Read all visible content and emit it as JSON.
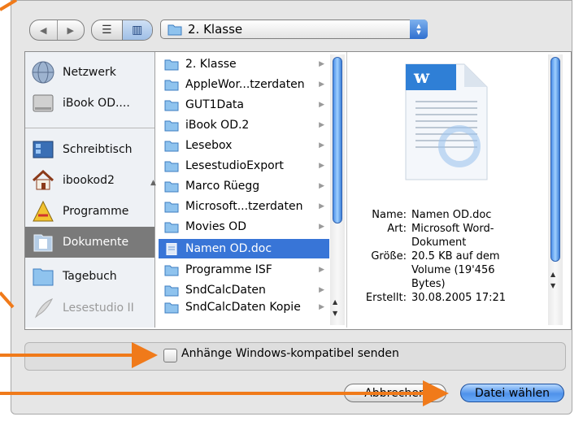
{
  "toolbar": {
    "nav_back": "◀",
    "nav_forward": "▶",
    "view_list": "☰",
    "view_columns": "▥",
    "path": "2. Klasse"
  },
  "sidebar": {
    "items": [
      {
        "label": "Netzwerk",
        "icon": "network-globe-icon"
      },
      {
        "label": "iBook OD....",
        "icon": "hard-disk-icon"
      },
      {
        "label": "Schreibtisch",
        "icon": "desktop-icon"
      },
      {
        "label": "ibookod2",
        "icon": "home-icon"
      },
      {
        "label": "Programme",
        "icon": "applications-icon"
      },
      {
        "label": "Dokumente",
        "icon": "documents-icon"
      },
      {
        "label": "Tagebuch",
        "icon": "folder-icon"
      },
      {
        "label": "Lesestudio II",
        "icon": "feather-icon"
      }
    ]
  },
  "column": {
    "items": [
      {
        "label": "2. Klasse"
      },
      {
        "label": "AppleWor...tzerdaten"
      },
      {
        "label": "GUT1Data"
      },
      {
        "label": "iBook OD.2"
      },
      {
        "label": "Lesebox"
      },
      {
        "label": "LesestudioExport"
      },
      {
        "label": "Marco Rüegg"
      },
      {
        "label": "Microsoft...tzerdaten"
      },
      {
        "label": "Movies OD"
      },
      {
        "label": "Namen OD.doc"
      },
      {
        "label": "Programme ISF"
      },
      {
        "label": "SndCalcDaten"
      },
      {
        "label": "SndCalcDaten Kopie"
      }
    ]
  },
  "preview": {
    "name_key": "Name:",
    "name_val": "Namen OD.doc",
    "kind_key": "Art:",
    "kind_val": "Microsoft Word-Dokument",
    "size_key": "Größe:",
    "size_val": "20.5 KB auf dem Volume (19'456 Bytes)",
    "created_key": "Erstellt:",
    "created_val": "30.08.2005 17:21"
  },
  "options": {
    "checkbox_label": "Anhänge Windows-kompatibel senden"
  },
  "buttons": {
    "cancel": "Abbrechen",
    "ok": "Datei wählen"
  },
  "colors": {
    "selection": "#3875d7",
    "annotation_arrow": "#f07a1a",
    "default_button": "#4f92ea"
  }
}
